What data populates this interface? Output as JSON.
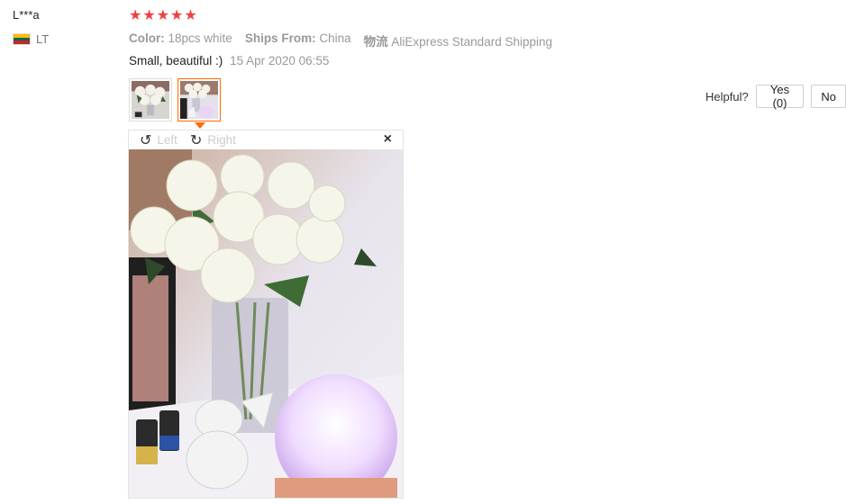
{
  "reviewer": {
    "name": "L***a",
    "country": "LT"
  },
  "rating": {
    "stars": 5,
    "max": 5
  },
  "meta": {
    "color_label": "Color:",
    "color_value": "18pcs white",
    "ships_label": "Ships From:",
    "ships_value": "China",
    "logistics_label": "物流",
    "logistics_value": "AliExpress Standard Shipping"
  },
  "review": {
    "text": "Small, beautiful :)",
    "date": "15 Apr 2020 06:55"
  },
  "viewer": {
    "rotate_left_label": "Left",
    "rotate_right_label": "Right",
    "close_symbol": "×"
  },
  "helpful": {
    "label": "Helpful?",
    "yes_label": "Yes (0)",
    "no_label": "No"
  },
  "colors": {
    "star": "#f03f3f",
    "active_thumb_border": "#ff6a00"
  }
}
